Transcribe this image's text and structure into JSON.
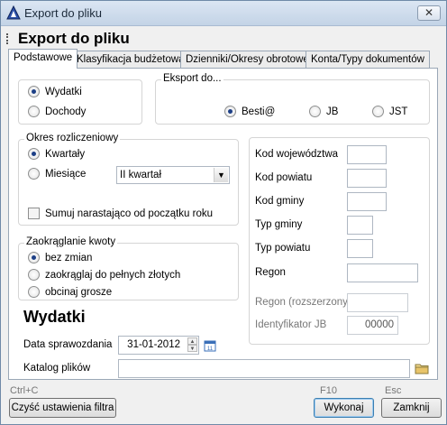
{
  "window": {
    "title": "Export do pliku",
    "close_glyph": "✕"
  },
  "header": {
    "title": "Export do pliku"
  },
  "tabs": [
    {
      "label": "Podstawowe",
      "active": true
    },
    {
      "label": "Klasyfikacja budżetowa",
      "active": false
    },
    {
      "label": "Dzienniki/Okresy obrotowe",
      "active": false
    },
    {
      "label": "Konta/Typy dokumentów",
      "active": false
    }
  ],
  "type_group": {
    "options": [
      {
        "label": "Wydatki",
        "selected": true
      },
      {
        "label": "Dochody",
        "selected": false
      }
    ]
  },
  "export_group": {
    "legend": "Eksport do...",
    "options": [
      {
        "label": "Besti@",
        "selected": true
      },
      {
        "label": "JB",
        "selected": false
      },
      {
        "label": "JST",
        "selected": false
      }
    ]
  },
  "period_group": {
    "legend": "Okres rozliczeniowy",
    "options": [
      {
        "label": "Kwartały",
        "selected": true
      },
      {
        "label": "Miesiące",
        "selected": false
      }
    ],
    "period_select": "II kwartał",
    "cumulative_label": "Sumuj narastająco od początku roku",
    "cumulative_checked": false
  },
  "rounding_group": {
    "legend": "Zaokrąglanie kwoty",
    "options": [
      {
        "label": "bez zmian",
        "selected": true
      },
      {
        "label": "zaokrąglaj do pełnych złotych",
        "selected": false
      },
      {
        "label": "obcinaj grosze",
        "selected": false
      }
    ]
  },
  "codes": {
    "kod_wojewodztwa": {
      "label": "Kod województwa",
      "value": ""
    },
    "kod_powiatu": {
      "label": "Kod powiatu",
      "value": ""
    },
    "kod_gminy": {
      "label": "Kod gminy",
      "value": ""
    },
    "typ_gminy": {
      "label": "Typ gminy",
      "value": ""
    },
    "typ_powiatu": {
      "label": "Typ powiatu",
      "value": ""
    },
    "regon": {
      "label": "Regon",
      "value": ""
    },
    "regon_ext": {
      "label": "Regon (rozszerzony)",
      "value": ""
    },
    "identyfikator_jb": {
      "label": "Identyfikator JB",
      "value": "00000"
    }
  },
  "section": {
    "title": "Wydatki"
  },
  "report_date": {
    "label": "Data sprawozdania",
    "value": "31-01-2012",
    "calendar_glyph": "11"
  },
  "file_catalog": {
    "label": "Katalog plików",
    "value": ""
  },
  "footer": {
    "clear_hint": "Ctrl+C",
    "clear_label": "Czyść ustawienia filtra",
    "execute_hint": "F10",
    "execute_label": "Wykonaj",
    "close_hint": "Esc",
    "close_label": "Zamknij"
  }
}
